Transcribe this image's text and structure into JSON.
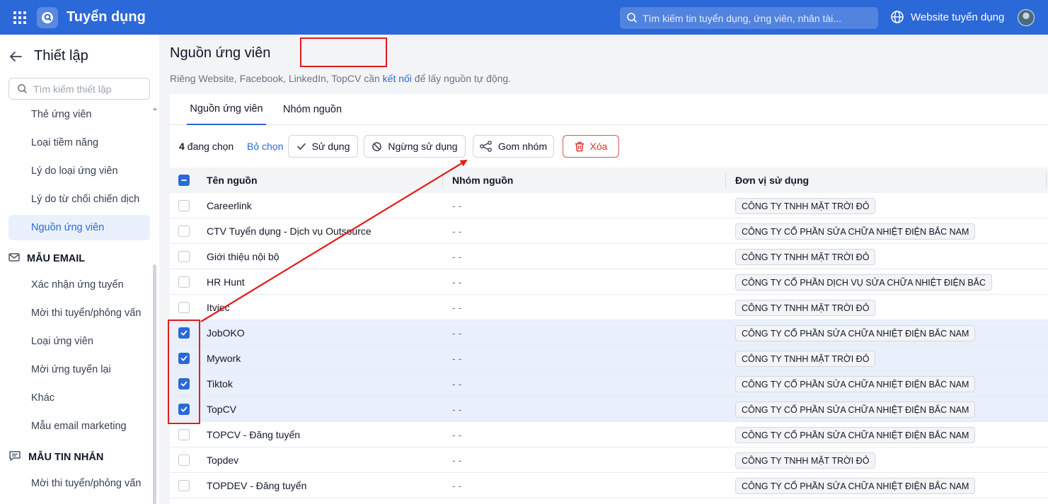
{
  "header": {
    "app_title": "Tuyển dụng",
    "search_placeholder": "Tìm kiếm tin tuyển dụng, ứng viên, nhân tài...",
    "website_link": "Website tuyển dụng",
    "brand_color": "#2b68d8"
  },
  "sidebar": {
    "title": "Thiết lập",
    "search_placeholder": "Tìm kiếm thiết lập",
    "items_top": [
      "Thẻ ứng viên",
      "Loại tiềm năng",
      "Lý do loại ứng viên",
      "Lý do từ chối chiến dịch",
      "Nguồn ứng viên"
    ],
    "active_item": "Nguồn ứng viên",
    "section_email": "MẪU EMAIL",
    "items_email": [
      "Xác nhận ứng tuyển",
      "Mời thi tuyển/phỏng vấn",
      "Loại ứng viên",
      "Mời ứng tuyển lại",
      "Khác",
      "Mẫu email marketing"
    ],
    "section_sms": "MẪU TIN NHẮN",
    "items_sms": [
      "Mời thi tuyển/phỏng vấn"
    ]
  },
  "page": {
    "title": "Nguồn ứng viên",
    "subtitle_before": "Riêng Website, Facebook, LinkedIn, TopCV cần ",
    "subtitle_link": "kết nối",
    "subtitle_after": " để lấy nguồn tự động."
  },
  "tabs": [
    "Nguồn ứng viên",
    "Nhóm nguồn"
  ],
  "toolbar": {
    "selected_count": "4",
    "selected_label": "đang chọn",
    "clear_label": "Bỏ chọn",
    "use_label": "Sử dụng",
    "stop_label": "Ngừng sử dụng",
    "group_label": "Gom nhóm",
    "delete_label": "Xóa"
  },
  "table": {
    "columns": [
      "Tên nguồn",
      "Nhóm nguồn",
      "Đơn vị sử dụng"
    ],
    "rows": [
      {
        "name": "Careerlink",
        "group": "- -",
        "unit": "CÔNG TY TNHH MẶT TRỜI ĐỎ",
        "checked": false
      },
      {
        "name": "CTV Tuyển dụng - Dịch vụ Outsource",
        "group": "- -",
        "unit": "CÔNG TY CỔ PHẦN SỬA CHỮA NHIỆT ĐIỆN BẮC NAM",
        "checked": false
      },
      {
        "name": "Giới thiệu nội bộ",
        "group": "- -",
        "unit": "CÔNG TY TNHH MẶT TRỜI ĐỎ",
        "checked": false
      },
      {
        "name": "HR Hunt",
        "group": "- -",
        "unit": "CÔNG TY CỔ PHẦN DỊCH VỤ SỬA CHỮA NHIỆT ĐIỆN BẮC",
        "checked": false
      },
      {
        "name": "Itviec",
        "group": "- -",
        "unit": "CÔNG TY TNHH MẶT TRỜI ĐỎ",
        "checked": false
      },
      {
        "name": "JobOKO",
        "group": "- -",
        "unit": "CÔNG TY CỔ PHẦN SỬA CHỮA NHIỆT ĐIỆN BẮC NAM",
        "checked": true
      },
      {
        "name": "Mywork",
        "group": "- -",
        "unit": "CÔNG TY TNHH MẶT TRỜI ĐỎ",
        "checked": true
      },
      {
        "name": "Tiktok",
        "group": "- -",
        "unit": "CÔNG TY CỔ PHẦN SỬA CHỮA NHIỆT ĐIỆN BẮC NAM",
        "checked": true
      },
      {
        "name": "TopCV",
        "group": "- -",
        "unit": "CÔNG TY CỔ PHẦN SỬA CHỮA NHIỆT ĐIỆN BẮC NAM",
        "checked": true
      },
      {
        "name": "TOPCV - Đăng tuyển",
        "group": "- -",
        "unit": "CÔNG TY CỔ PHẦN SỬA CHỮA NHIỆT ĐIỆN BẮC NAM",
        "checked": false
      },
      {
        "name": "Topdev",
        "group": "- -",
        "unit": "CÔNG TY TNHH MẶT TRỜI ĐỎ",
        "checked": false
      },
      {
        "name": "TOPDEV - Đăng tuyển",
        "group": "- -",
        "unit": "CÔNG TY CỔ PHẦN SỬA CHỮA NHIỆT ĐIỆN BẮC NAM",
        "checked": false
      }
    ]
  },
  "annotation_color": "#e31b1b"
}
